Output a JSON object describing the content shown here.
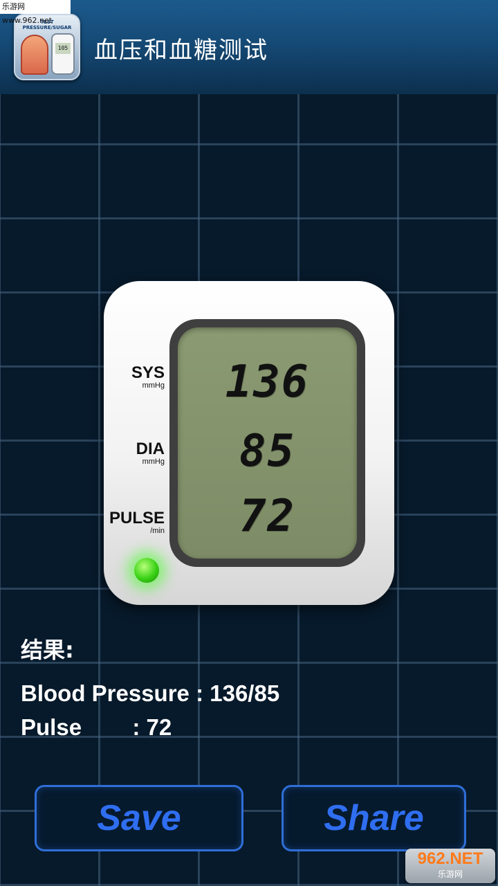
{
  "watermark": {
    "top_text": "乐游网 www.962.net",
    "bottom_main": "962.NET",
    "bottom_sub": "乐游网"
  },
  "header": {
    "icon_caption": "TEST PRESSURE/SUGAR",
    "icon_meter_value": "105",
    "title": "血压和血糖测试"
  },
  "monitor": {
    "sys": {
      "label": "SYS",
      "unit": "mmHg",
      "value": "136"
    },
    "dia": {
      "label": "DIA",
      "unit": "mmHg",
      "value": "85"
    },
    "pulse": {
      "label": "PULSE",
      "unit": "/min",
      "value": "72"
    },
    "led_color": "#39d115"
  },
  "results": {
    "heading": "结果:",
    "blood_pressure": "Blood Pressure : 136/85",
    "pulse": "Pulse        : 72"
  },
  "buttons": {
    "save": "Save",
    "share": "Share"
  },
  "colors": {
    "accent_blue": "#2f6ef0",
    "background": "#071a2b"
  }
}
